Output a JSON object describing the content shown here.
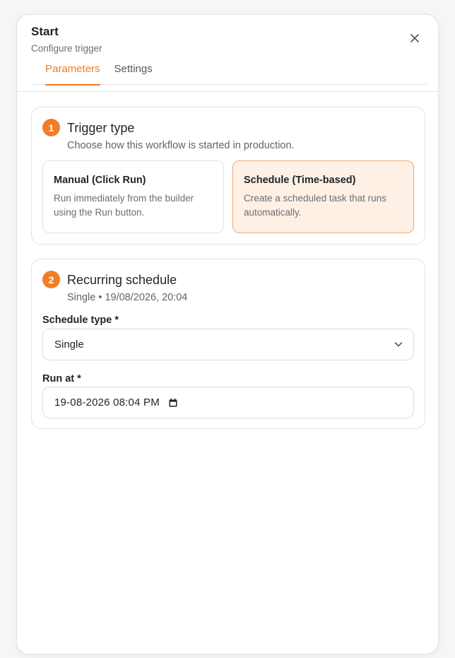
{
  "header": {
    "title": "Start",
    "subtitle": "Configure trigger",
    "close_icon": "close-icon"
  },
  "tabs": [
    {
      "label": "Parameters",
      "active": true
    },
    {
      "label": "Settings",
      "active": false
    }
  ],
  "trigger": {
    "step": "1",
    "title": "Trigger type",
    "subtitle": "Choose how this workflow is started in production.",
    "options": [
      {
        "title": "Manual (Click Run)",
        "desc": "Run immediately from the builder using the Run button.",
        "selected": false
      },
      {
        "title": "Schedule (Time-based)",
        "desc": "Create a scheduled task that runs automatically.",
        "selected": true
      }
    ]
  },
  "schedule": {
    "step": "2",
    "title": "Recurring schedule",
    "subtitle": "Single • 19/08/2026, 20:04",
    "type_label": "Schedule type *",
    "type_value": "Single",
    "run_label": "Run at *",
    "run_value": "19-08-2026 08:04 PM"
  },
  "colors": {
    "accent": "#f07a22",
    "selected_bg": "#fef0e5"
  }
}
